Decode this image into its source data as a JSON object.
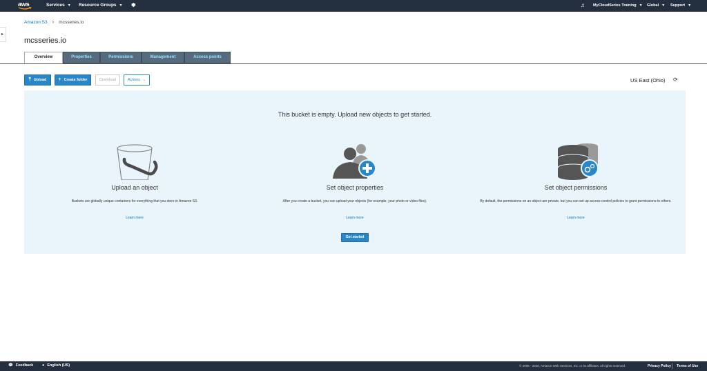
{
  "topnav": {
    "logo": "aws",
    "services": "Services",
    "resource_groups": "Resource Groups",
    "account": "MyCloudSeries Training",
    "region_menu": "Global",
    "support": "Support"
  },
  "breadcrumb": {
    "root": "Amazon S3",
    "current": "mcsseries.io"
  },
  "page_title": "mcsseries.io",
  "tabs": [
    {
      "label": "Overview",
      "active": true
    },
    {
      "label": "Properties",
      "active": false
    },
    {
      "label": "Permissions",
      "active": false
    },
    {
      "label": "Management",
      "active": false
    },
    {
      "label": "Access points",
      "active": false
    }
  ],
  "toolbar": {
    "upload": "Upload",
    "create_folder": "Create folder",
    "download": "Download",
    "actions": "Actions"
  },
  "region": "US East (Ohio)",
  "empty": {
    "message": "This bucket is empty. Upload new objects to get started.",
    "columns": [
      {
        "title": "Upload an object",
        "desc": "Buckets are globally unique containers for everything that you store in Amazon S3.",
        "link": "Learn more"
      },
      {
        "title": "Set object properties",
        "desc": "After you create a bucket, you can upload your objects (for example, your photo or video files).",
        "link": "Learn more"
      },
      {
        "title": "Set object permissions",
        "desc": "By default, the permissions on an object are private, but you can set up access control policies to grant permissions to others.",
        "link": "Learn more"
      }
    ],
    "get_started": "Get started"
  },
  "footer": {
    "feedback": "Feedback",
    "language": "English (US)",
    "copyright": "© 2008 - 2020, Amazon Web Services, Inc. or its affiliates. All rights reserved.",
    "privacy": "Privacy Policy",
    "terms": "Terms of Use"
  },
  "colors": {
    "nav_bg": "#232f3e",
    "accent": "#2a87c7",
    "panel_bg": "#eaf4fb",
    "tab_inactive": "#566c7e"
  }
}
